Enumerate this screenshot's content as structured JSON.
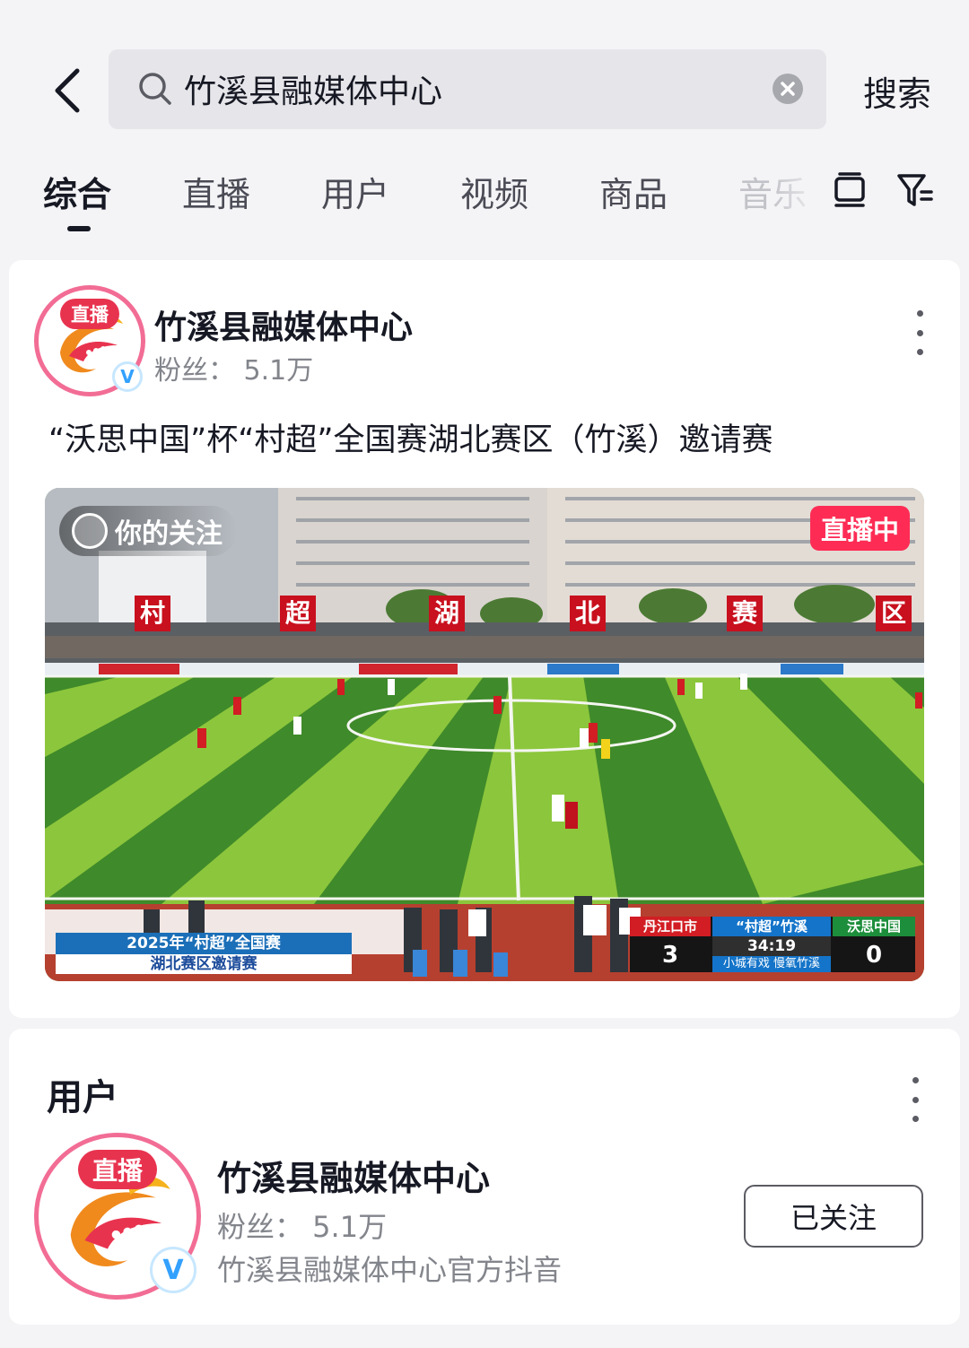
{
  "search": {
    "query": "竹溪县融媒体中心",
    "submit_label": "搜索"
  },
  "tabs": [
    {
      "label": "综合",
      "active": true
    },
    {
      "label": "直播",
      "active": false
    },
    {
      "label": "用户",
      "active": false
    },
    {
      "label": "视频",
      "active": false
    },
    {
      "label": "商品",
      "active": false
    },
    {
      "label": "音乐",
      "active": false
    }
  ],
  "icons": {
    "back": "chevron-left-icon",
    "search": "search-icon",
    "clear": "clear-icon",
    "layout": "layout-toggle-icon",
    "filter": "filter-icon",
    "more": "more-vertical-icon",
    "verified": "verified-badge-icon"
  },
  "colors": {
    "accent_live": "#fe2c55",
    "avatar_ring": "#f26d95",
    "secondary_text": "#83858c"
  },
  "live_card": {
    "avatar_badge": "直播",
    "name": "竹溪县融媒体中心",
    "fans": "粉丝：  5.1万",
    "title": "“沃思中国”杯“村超”全国赛湖北赛区（竹溪）邀请赛",
    "video": {
      "follow_tag": "你的关注",
      "live_badge": "直播中",
      "banner_line1": "2025年“村超”全国赛",
      "banner_line2": "湖北赛区邀请赛",
      "stadium_letters": [
        "村",
        "超",
        "湖",
        "北",
        "赛",
        "区"
      ],
      "scoreboard": {
        "home_team": "丹江口市",
        "home_score": "3",
        "center_title": "“村超”竹溪",
        "clock": "34:19",
        "slogan": "小城有戏 慢氧竹溪",
        "away_team": "沃思中国",
        "away_score": "0"
      }
    }
  },
  "users_section": {
    "title": "用户",
    "user": {
      "avatar_badge": "直播",
      "name": "竹溪县融媒体中心",
      "fans": "粉丝：  5.1万",
      "description": "竹溪县融媒体中心官方抖音",
      "follow_label": "已关注"
    }
  }
}
